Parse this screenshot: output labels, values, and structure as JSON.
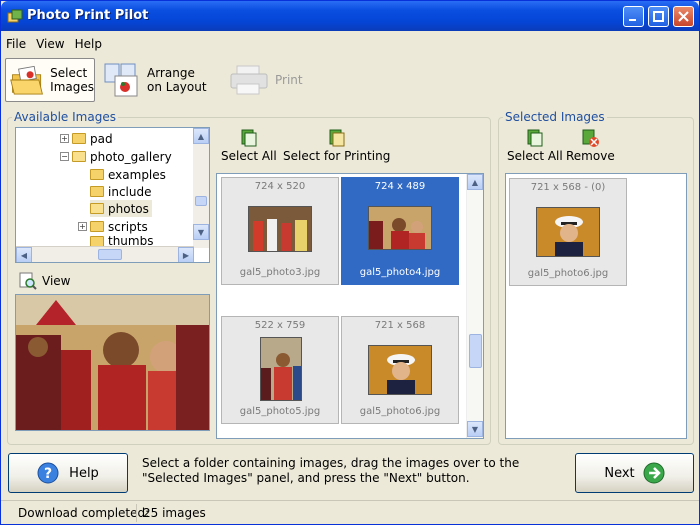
{
  "window": {
    "title": "Photo Print Pilot"
  },
  "menu": [
    "File",
    "View",
    "Help"
  ],
  "toolbar": {
    "select_images": "Select\nImages",
    "arrange": "Arrange\non Layout",
    "print": "Print"
  },
  "available": {
    "title": "Available Images",
    "tree": [
      {
        "label": "pad",
        "indent": 1,
        "expander": "+"
      },
      {
        "label": "photo_gallery",
        "indent": 1,
        "expander": "-"
      },
      {
        "label": "examples",
        "indent": 2,
        "expander": ""
      },
      {
        "label": "include",
        "indent": 2,
        "expander": ""
      },
      {
        "label": "photos",
        "indent": 2,
        "expander": "",
        "selected": true
      },
      {
        "label": "scripts",
        "indent": 2,
        "expander": "+"
      },
      {
        "label": "thumbs",
        "indent": 2,
        "expander": ""
      }
    ],
    "select_all": "Select All",
    "select_for_printing": "Select for Printing",
    "view_label": "View",
    "thumbnails": [
      {
        "dims": "724 x 520",
        "name": "gal5_photo3.jpg",
        "selected": false
      },
      {
        "dims": "724 x 489",
        "name": "gal5_photo4.jpg",
        "selected": true
      },
      {
        "dims": "522 x 759",
        "name": "gal5_photo5.jpg",
        "selected": false
      },
      {
        "dims": "721 x 568",
        "name": "gal5_photo6.jpg",
        "selected": false
      }
    ]
  },
  "selected": {
    "title": "Selected Images",
    "select_all": "Select All",
    "remove": "Remove",
    "thumbnails": [
      {
        "dims": "721 x 568 - (0)",
        "name": "gal5_photo6.jpg"
      }
    ]
  },
  "footer": {
    "help": "Help",
    "hint_line1": "Select a folder containing images, drag the images over to the",
    "hint_line2": "\"Selected Images\" panel, and press the \"Next\" button.",
    "next": "Next"
  },
  "status": {
    "text": "Download completed:",
    "count": "25 images"
  },
  "colors": {
    "titlebar": "#0a4fe0",
    "selection": "#316ac5",
    "group_title": "#1f4fa0"
  }
}
